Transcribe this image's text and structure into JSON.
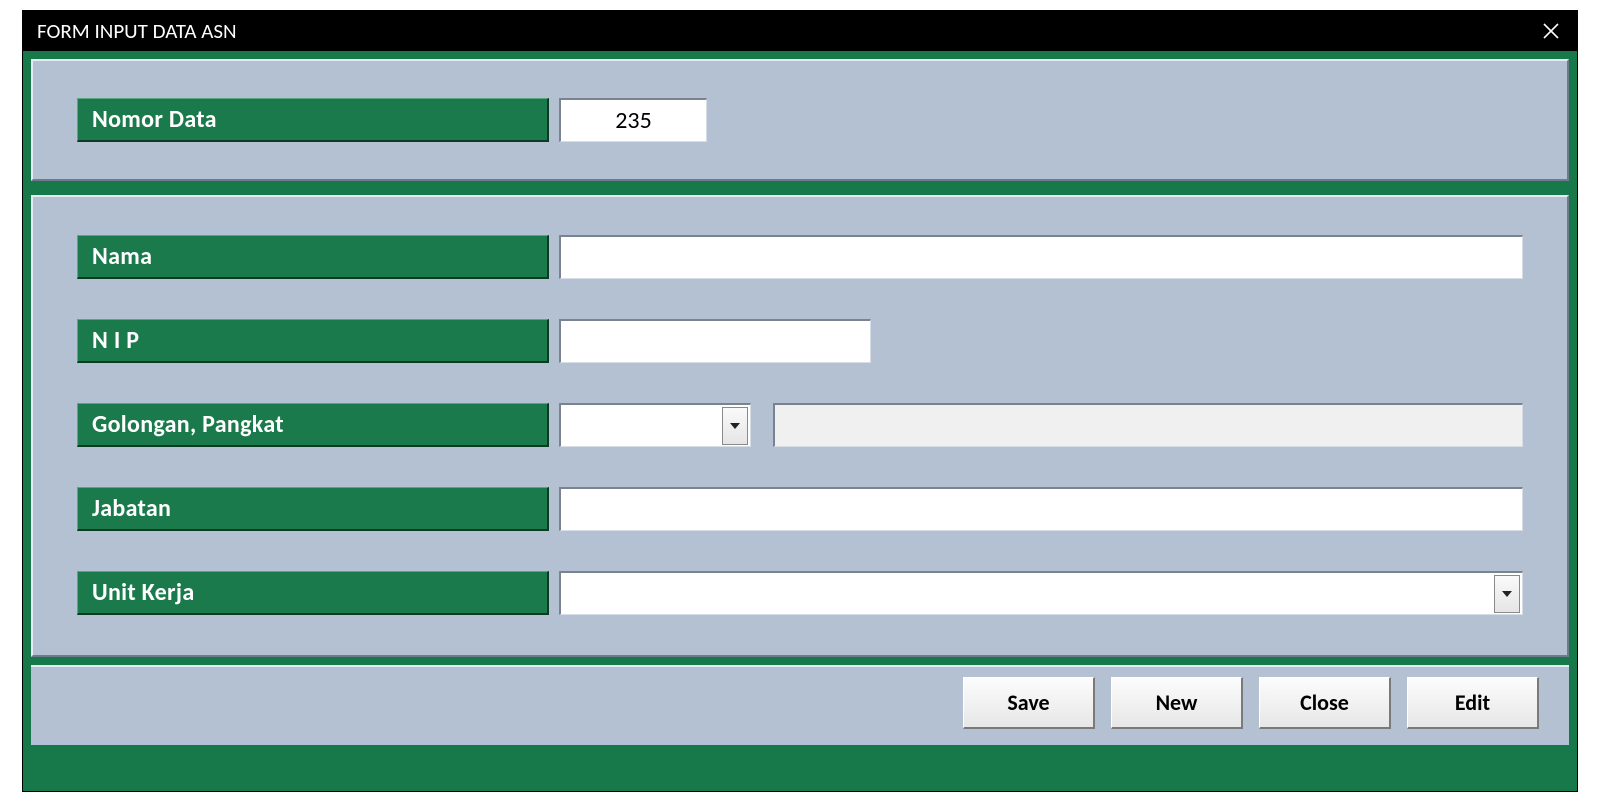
{
  "title": "FORM INPUT DATA ASN",
  "labels": {
    "nomor_data": "Nomor Data",
    "nama": "Nama",
    "nip": "N I P",
    "golongan": "Golongan, Pangkat",
    "jabatan": "Jabatan",
    "unit_kerja": "Unit Kerja"
  },
  "values": {
    "nomor_data": "235",
    "nama": "",
    "nip": "",
    "golongan_code": "",
    "golongan_desc": "",
    "jabatan": "",
    "unit_kerja": ""
  },
  "buttons": {
    "save": "Save",
    "new": "New",
    "close": "Close",
    "edit": "Edit"
  }
}
